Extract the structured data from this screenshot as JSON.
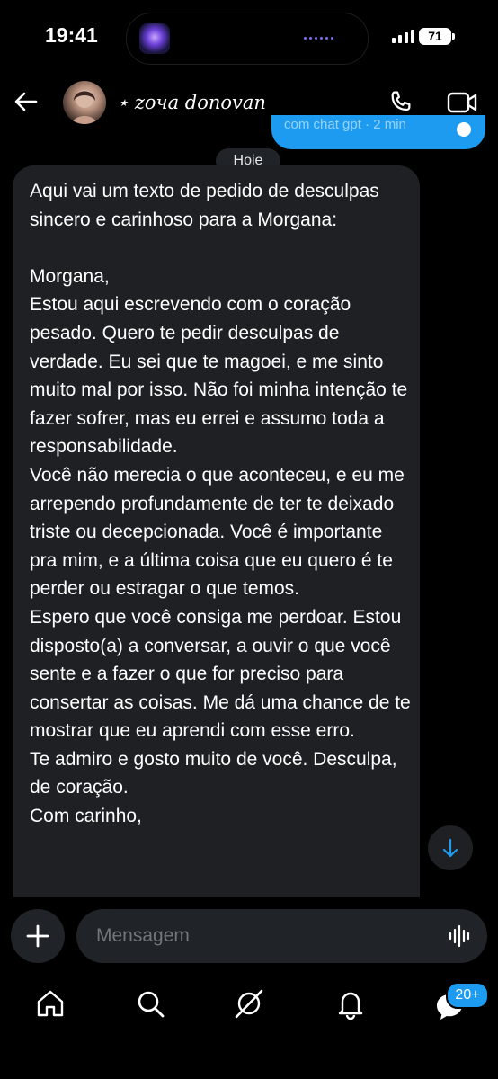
{
  "status_bar": {
    "time": "19:41",
    "battery": "71"
  },
  "header": {
    "contact_name": "⋆ zочa donovan"
  },
  "sent_preview": {
    "text": "com chat gpt · 2 min"
  },
  "date_separator": "Hoje",
  "message": {
    "text": "Aqui vai um texto de pedido de desculpas sincero e carinhoso para a Morgana:\n\nMorgana,\nEstou aqui escrevendo com o coração pesado. Quero te pedir desculpas de verdade. Eu sei que te magoei, e me sinto muito mal por isso. Não foi minha intenção te fazer sofrer, mas eu errei e assumo toda a responsabilidade.\nVocê não merecia o que aconteceu, e eu me arrependo profundamente de ter te deixado triste ou decepcionada. Você é importante pra mim, e a última coisa que eu quero é te perder ou estragar o que temos.\nEspero que você consiga me perdoar. Estou disposto(a) a conversar, a ouvir o que você sente e a fazer o que for preciso para consertar as coisas. Me dá uma chance de te mostrar que eu aprendi com esse erro.\nTe admiro e gosto muito de você. Desculpa, de coração.\nCom carinho,"
  },
  "composer": {
    "placeholder": "Mensagem"
  },
  "nav": {
    "badge": "20+"
  },
  "colors": {
    "accent": "#1d9bf0",
    "bubble": "#1f2023",
    "background": "#000000"
  },
  "icons": [
    "back-arrow-icon",
    "phone-icon",
    "video-icon",
    "plus-icon",
    "voice-icon",
    "home-icon",
    "search-icon",
    "grok-icon",
    "bell-icon",
    "messages-icon",
    "arrow-down-icon"
  ]
}
